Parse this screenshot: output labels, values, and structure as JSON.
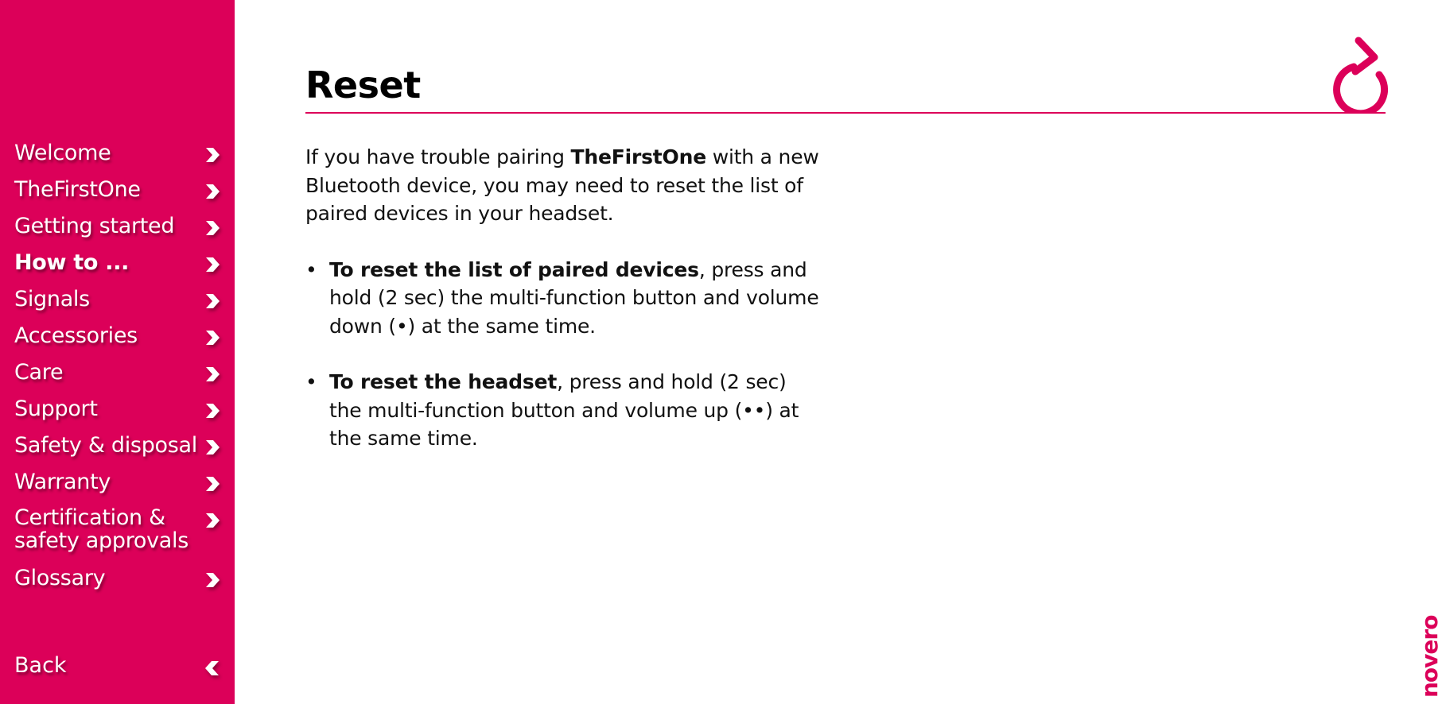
{
  "sidebar": {
    "items": [
      {
        "label": "Welcome",
        "active": false
      },
      {
        "label": "TheFirstOne",
        "active": false
      },
      {
        "label": "Getting started",
        "active": false
      },
      {
        "label": "How to ...",
        "active": true
      },
      {
        "label": "Signals",
        "active": false
      },
      {
        "label": "Accessories",
        "active": false
      },
      {
        "label": "Care",
        "active": false
      },
      {
        "label": "Support",
        "active": false
      },
      {
        "label": "Safety & disposal",
        "active": false
      },
      {
        "label": "Warranty",
        "active": false
      },
      {
        "label": "Certification & safety approvals",
        "active": false
      },
      {
        "label": "Glossary",
        "active": false
      }
    ],
    "back_label": "Back"
  },
  "page": {
    "title": "Reset",
    "intro_before": "If you have trouble pairing ",
    "intro_bold": "TheFirstOne",
    "intro_after": " with a new Bluetooth device, you may need to reset the list of paired devices in your headset.",
    "bullets": [
      {
        "bold": "To reset the list of paired devices",
        "text": ", press and hold (2 sec) the multi-function button and volume down (•) at the same time."
      },
      {
        "bold": "To reset the headset",
        "text": ", press and hold (2 sec) the multi-function button and volume up (••) at the same time."
      }
    ]
  },
  "icons": {
    "header": "reset-arrow-icon",
    "nav": "chevron-right-icon",
    "back": "chevron-left-icon"
  },
  "brand": {
    "logo_text": "novero",
    "accent_color": "#dc0059"
  }
}
